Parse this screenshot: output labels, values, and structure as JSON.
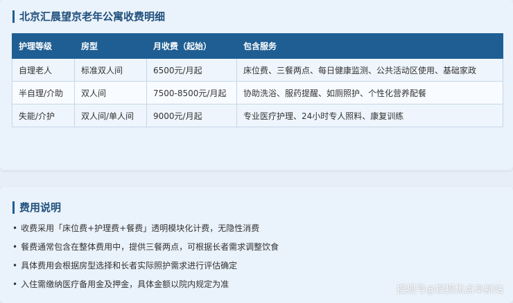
{
  "section1": {
    "title": "北京汇晨望京老年公寓收费明细"
  },
  "table": {
    "headers": [
      "护理等级",
      "房型",
      "月收费（起始）",
      "包含服务"
    ],
    "rows": [
      [
        "自理老人",
        "标准双人间",
        "6500元/月起",
        "床位费、三餐两点、每日健康监测、公共活动区使用、基础家政"
      ],
      [
        "半自理/介助",
        "双人间",
        "7500-8500元/月起",
        "协助洗浴、服药提醒、如厕照护、个性化营养配餐"
      ],
      [
        "失能/介护",
        "双人间/单人间",
        "9000元/月起",
        "专业医疗护理、24小时专人照料、康复训练"
      ]
    ]
  },
  "section2": {
    "title": "费用说明",
    "bullet": "•",
    "notes": [
      "收费采用「床位费+护理费+餐费」透明模块化计费，无隐性消费",
      "餐费通常包含在整体费用中，提供三餐两点，可根据长者需求调整饮食",
      "具体费用会根据房型选择和长者实际照护需求进行评估确定",
      "入住需缴纳医疗备用金及押金，具体金额以院内规定为准"
    ]
  },
  "watermark": "搜狐号@搜狐焦点阜新站",
  "colors": {
    "accent": "#1f5e93",
    "title": "#1f4f7c"
  }
}
